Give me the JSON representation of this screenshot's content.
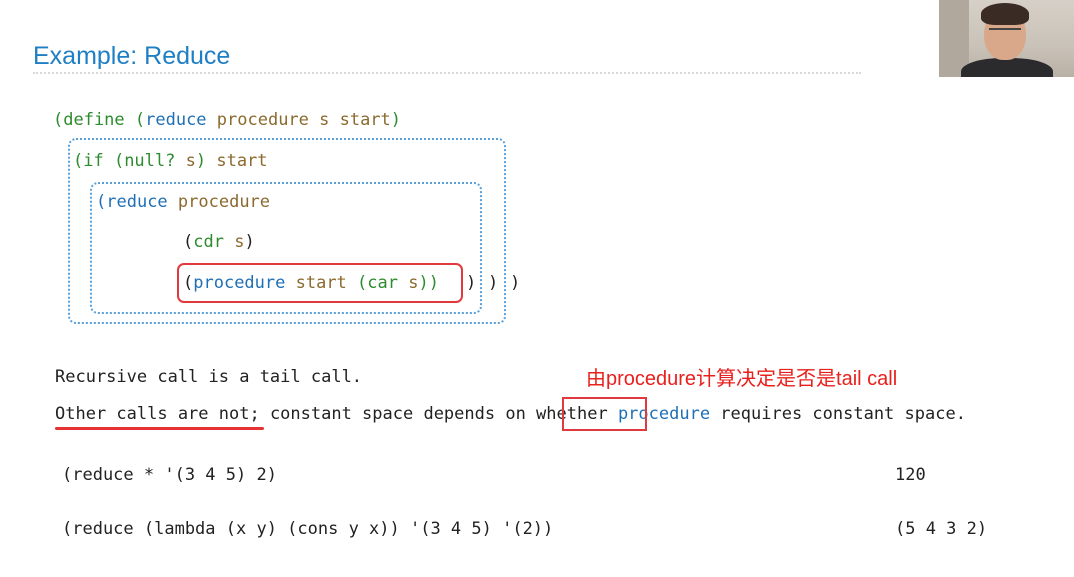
{
  "slide": {
    "title": "Example: Reduce",
    "code": {
      "l1_open": "(define (",
      "l1_reduce": "reduce",
      "l1_rest": " procedure s start",
      "l1_close": ")",
      "l2_open": "(if (",
      "l2_null": "null?",
      "l2_s": " s",
      "l2_close": ") ",
      "l2_start": "start",
      "l3_open": "(",
      "l3_reduce": "reduce",
      "l3_proc": " procedure",
      "l4_open": "(",
      "l4_cdr": "cdr",
      "l4_s": " s",
      "l4_close": ")",
      "l5_open": "(",
      "l5_proc": "procedure",
      "l5_start": " start ",
      "l5_inner_open": "(",
      "l5_car": "car",
      "l5_s": " s",
      "l5_inner_close": "))",
      "close1": ")",
      "close2": ")",
      "close3": ")"
    },
    "text1": "Recursive call is a tail call.",
    "text2_a": "Other calls are not",
    "text2_b": "; constant space depends on ",
    "text2_whether": "whether",
    "text2_proc": " procedure",
    "text2_c": " requires constant space.",
    "ex1_expr": "(reduce * '(3 4 5) 2)",
    "ex1_result": "120",
    "ex2_expr": "(reduce (lambda (x y) (cons y x)) '(3 4 5) '(2))",
    "ex2_result": "(5 4 3 2)"
  },
  "annotation": {
    "text": "由procedure计算决定是否是tail call",
    "color": "#e8201e"
  },
  "colors": {
    "title": "#1f7fc4",
    "keyword_green": "#2e8b2e",
    "name_blue": "#1f6fb5",
    "param_brown": "#8b6a2e",
    "highlight_red": "#e0393e"
  }
}
